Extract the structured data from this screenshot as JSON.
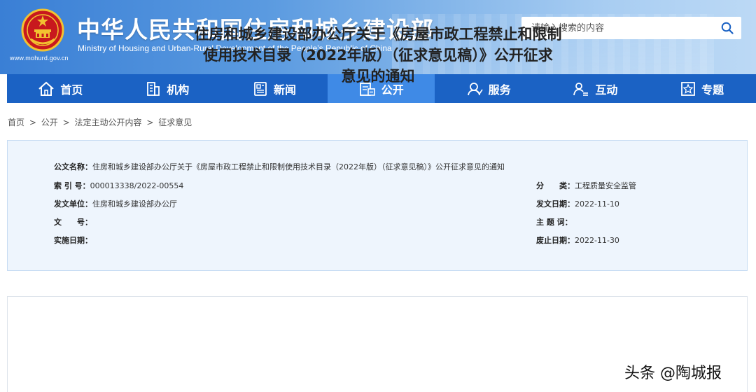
{
  "header": {
    "title": "中华人民共和国住房和城乡建设部",
    "subtitle": "Ministry of Housing and Urban-Rural Development of the People’s Republic of China",
    "url": "www.mohurd.gov.cn",
    "search_placeholder": "请输入搜索的内容",
    "icons": {
      "emblem": "national-emblem",
      "search": "search-icon"
    }
  },
  "nav": {
    "items": [
      {
        "label": "首页",
        "icon": "home-icon"
      },
      {
        "label": "机构",
        "icon": "building-icon"
      },
      {
        "label": "新闻",
        "icon": "newspaper-icon"
      },
      {
        "label": "公开",
        "icon": "document-icon",
        "active": true
      },
      {
        "label": "服务",
        "icon": "service-icon"
      },
      {
        "label": "互动",
        "icon": "interact-icon"
      },
      {
        "label": "专题",
        "icon": "topic-icon"
      }
    ]
  },
  "breadcrumb": {
    "items": [
      "首页",
      "公开",
      "法定主动公开内容",
      "征求意见"
    ],
    "separator": ">"
  },
  "meta": {
    "doc_name_label": "公文名称：",
    "doc_name": "住房和城乡建设部办公厅关于《房屋市政工程禁止和限制使用技术目录（2022年版）（征求意见稿）》公开征求意见的通知",
    "index_label": "索 引 号：",
    "index": "000013338/2022-00554",
    "category_label": "分　　类：",
    "category": "工程质量安全监管",
    "issuer_label": "发文单位：",
    "issuer": "住房和城乡建设部办公厅",
    "issue_date_label": "发文日期：",
    "issue_date": "2022-11-10",
    "doc_no_label": "文　　号：",
    "doc_no": "",
    "keywords_label": "主 题 词：",
    "keywords": "",
    "effective_label": "实施日期：",
    "effective": "",
    "expiry_label": "废止日期：",
    "expiry": "2022-11-30"
  },
  "article": {
    "title_line1": "住房和城乡建设部办公厅关于《房屋市政工程禁止和限制",
    "title_line2": "使用技术目录（2022年版）（征求意见稿）》公开征求",
    "title_line3": "意见的通知"
  },
  "watermark": "头条 @陶城报",
  "colors": {
    "nav": "#1b62c4",
    "nav_active": "#3f8ae6",
    "meta_bg": "#eef5fd"
  }
}
